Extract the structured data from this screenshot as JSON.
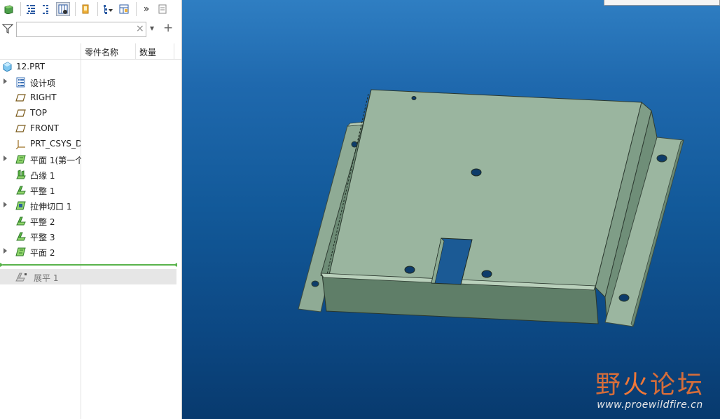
{
  "filter": {
    "value": "",
    "clear_icon": "×",
    "dropdown_icon": "▾",
    "add_icon": "+"
  },
  "toolbar": {
    "more_icon": "»"
  },
  "columns": {
    "name": "零件名称",
    "quantity": "数量"
  },
  "tree": {
    "root": "12.PRT",
    "items": [
      {
        "label": "设计项",
        "icon": "layers-icon",
        "expandable": true
      },
      {
        "label": "RIGHT",
        "icon": "datum-plane-icon",
        "expandable": false
      },
      {
        "label": "TOP",
        "icon": "datum-plane-icon",
        "expandable": false
      },
      {
        "label": "FRONT",
        "icon": "datum-plane-icon",
        "expandable": false
      },
      {
        "label": "PRT_CSYS_DI",
        "icon": "csys-icon",
        "expandable": false
      },
      {
        "label": "平面 1(第一个",
        "icon": "planar-wall-icon",
        "expandable": true
      },
      {
        "label": "凸缘 1",
        "icon": "flange-wall-icon",
        "expandable": false
      },
      {
        "label": "平整 1",
        "icon": "flat-wall-icon",
        "expandable": false
      },
      {
        "label": "拉伸切口 1",
        "icon": "extrude-cut-icon",
        "expandable": true
      },
      {
        "label": "平整 2",
        "icon": "flat-wall-icon",
        "expandable": false
      },
      {
        "label": "平整 3",
        "icon": "flat-wall-icon",
        "expandable": false
      },
      {
        "label": "平面 2",
        "icon": "planar-wall-icon",
        "expandable": true
      }
    ],
    "suppressed": {
      "label": "展平 1",
      "icon": "flatten-icon"
    }
  },
  "watermark": {
    "part1": "野",
    "fire": "火",
    "part2": "论坛",
    "url": "www.proewildfire.cn"
  },
  "colors": {
    "viewport_top": "#2f7ec2",
    "viewport_bottom": "#083a6e",
    "model_face": "#9ab59f",
    "insert_line": "#59b34b"
  }
}
